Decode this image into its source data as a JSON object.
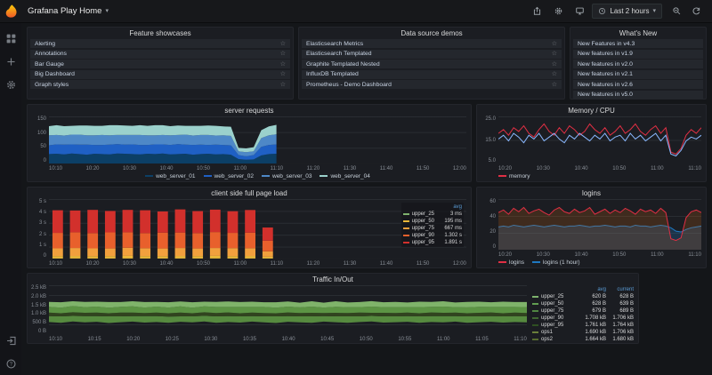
{
  "navbar": {
    "title": "Grafana Play Home",
    "time_range": "Last 2 hours"
  },
  "panels": {
    "feature_showcases": {
      "title": "Feature showcases",
      "star": true,
      "items": [
        "Alerting",
        "Annotations",
        "Bar Gauge",
        "Big Dashboard",
        "Graph styles"
      ]
    },
    "datasource_demos": {
      "title": "Data source demos",
      "star": true,
      "items": [
        "Elasticsearch Metrics",
        "Elasticsearch Templated",
        "Graphite Templated Nested",
        "InfluxDB Templated",
        "Prometheus - Demo Dashboard"
      ]
    },
    "whats_new": {
      "title": "What's New",
      "star": false,
      "items": [
        "New Features in v4.3",
        "New features in v1.9",
        "New features in v2.0",
        "New features in v2.1",
        "New features in v2.6",
        "New features in v5.0"
      ]
    },
    "server_requests": {
      "title": "server requests",
      "y_ticks": [
        "150",
        "100",
        "50",
        "0"
      ],
      "x_ticks": [
        "10:10",
        "10:20",
        "10:30",
        "10:40",
        "10:50",
        "11:00",
        "11:10",
        "11:20",
        "11:30",
        "11:40",
        "11:50",
        "12:00"
      ],
      "legend": [
        {
          "label": "web_server_01",
          "color": "#0c3f66"
        },
        {
          "label": "web_server_02",
          "color": "#1f60c4"
        },
        {
          "label": "web_server_03",
          "color": "#4e88c7"
        },
        {
          "label": "web_server_04",
          "color": "#9bd1cc"
        }
      ],
      "chart": {
        "type": "stacked_area",
        "ymax": 150,
        "span": 0.545,
        "series": [
          {
            "color": "#0c3f66",
            "values": [
              30,
              31,
              29,
              32,
              30,
              28,
              31,
              30,
              29,
              32,
              31,
              30,
              29,
              31,
              30,
              32,
              29,
              30,
              31,
              28,
              30,
              31,
              29,
              30,
              28,
              14,
              12,
              13,
              26,
              30,
              31
            ]
          },
          {
            "color": "#1f60c4",
            "values": [
              28,
              30,
              31,
              29,
              30,
              32,
              28,
              29,
              31,
              30,
              29,
              31,
              30,
              28,
              31,
              29,
              30,
              32,
              29,
              31,
              30,
              28,
              31,
              29,
              30,
              13,
              11,
              14,
              27,
              29,
              30
            ]
          },
          {
            "color": "#4e88c7",
            "values": [
              32,
              30,
              29,
              31,
              32,
              30,
              31,
              32,
              30,
              29,
              31,
              30,
              32,
              31,
              29,
              30,
              31,
              29,
              32,
              30,
              31,
              32,
              29,
              31,
              30,
              12,
              13,
              12,
              28,
              31,
              32
            ]
          },
          {
            "color": "#9bd1cc",
            "values": [
              29,
              31,
              30,
              28,
              29,
              31,
              30,
              29,
              32,
              31,
              30,
              29,
              31,
              30,
              32,
              31,
              29,
              30,
              28,
              31,
              29,
              30,
              31,
              28,
              29,
              11,
              12,
              13,
              25,
              28,
              30
            ]
          }
        ]
      }
    },
    "memory_cpu": {
      "title": "Memory / CPU",
      "y_ticks": [
        "25.0",
        "15.0",
        "5.0"
      ],
      "x_ticks": [
        "10:20",
        "10:30",
        "10:40",
        "10:50",
        "11:00",
        "11:10"
      ],
      "legend": [
        {
          "label": "memory",
          "color": "#e02f44"
        }
      ],
      "chart": {
        "type": "lines",
        "ymax": 25,
        "span": 1,
        "series": [
          {
            "color": "#e02f44",
            "values": [
              16,
              18,
              15,
              19,
              17,
              20,
              16,
              14,
              18,
              21,
              17,
              15,
              19,
              16,
              20,
              18,
              15,
              17,
              21,
              18,
              16,
              19,
              15,
              17,
              20,
              16,
              18,
              21,
              17,
              15,
              18,
              20,
              16,
              19,
              6,
              5,
              8,
              15,
              18,
              16,
              19
            ]
          },
          {
            "color": "#8ab8ff",
            "values": [
              13,
              15,
              12,
              16,
              14,
              11,
              15,
              13,
              16,
              12,
              14,
              16,
              13,
              11,
              15,
              13,
              16,
              14,
              12,
              15,
              13,
              16,
              12,
              14,
              15,
              12,
              16,
              13,
              15,
              12,
              14,
              16,
              12,
              15,
              5,
              4,
              7,
              12,
              14,
              13,
              15
            ]
          }
        ]
      }
    },
    "client_load": {
      "title": "client side full page load",
      "y_ticks": [
        "5 s",
        "4 s",
        "3 s",
        "2 s",
        "1 s",
        "0"
      ],
      "x_ticks": [
        "10:10",
        "10:20",
        "10:30",
        "10:40",
        "10:50",
        "11:00",
        "11:10",
        "11:20",
        "11:30",
        "11:40",
        "11:50",
        "12:00"
      ],
      "legend_table": {
        "headers": [
          "avg"
        ],
        "rows": [
          {
            "label": "upper_25",
            "color": "#7eb26d",
            "values": [
              "3 ms"
            ]
          },
          {
            "label": "upper_50",
            "color": "#eab839",
            "values": [
              "195 ms"
            ]
          },
          {
            "label": "upper_75",
            "color": "#f2a03d",
            "values": [
              "667 ms"
            ]
          },
          {
            "label": "upper_90",
            "color": "#e8602c",
            "values": [
              "1.302 s"
            ]
          },
          {
            "label": "upper_95",
            "color": "#d2302c",
            "values": [
              "1.891 s"
            ]
          }
        ]
      },
      "chart": {
        "type": "bars",
        "ymax": 5,
        "span": 0.545,
        "colors": [
          "#7eb26d",
          "#eab839",
          "#f2a03d",
          "#e8602c",
          "#d2302c"
        ],
        "stacks": [
          [
            0.01,
            0.2,
            0.65,
            1.3,
            1.9
          ],
          [
            0.01,
            0.21,
            0.67,
            1.32,
            1.83
          ],
          [
            0.01,
            0.19,
            0.66,
            1.28,
            1.95
          ],
          [
            0.01,
            0.2,
            0.64,
            1.35,
            1.8
          ],
          [
            0.01,
            0.22,
            0.68,
            1.3,
            1.88
          ],
          [
            0.01,
            0.2,
            0.66,
            1.27,
            1.92
          ],
          [
            0.01,
            0.19,
            0.65,
            1.33,
            1.78
          ],
          [
            0.01,
            0.21,
            0.67,
            1.3,
            1.94
          ],
          [
            0.01,
            0.2,
            0.64,
            1.29,
            1.85
          ],
          [
            0.01,
            0.22,
            0.66,
            1.34,
            1.88
          ],
          [
            0.01,
            0.2,
            0.67,
            1.28,
            1.82
          ],
          [
            0.01,
            0.21,
            0.65,
            1.31,
            1.9
          ],
          [
            0.01,
            0.15,
            0.45,
            0.9,
            1.1
          ]
        ]
      }
    },
    "logins": {
      "title": "logins",
      "y_ticks": [
        "60",
        "40",
        "20",
        "0"
      ],
      "x_ticks": [
        "10:20",
        "10:30",
        "10:40",
        "10:50",
        "11:00",
        "11:10"
      ],
      "legend": [
        {
          "label": "logins",
          "color": "#e02f44"
        },
        {
          "label": "logins (1 hour)",
          "color": "#1f78c1"
        }
      ],
      "chart": {
        "type": "lines",
        "ymax": 60,
        "span": 1,
        "series": [
          {
            "color": "#1f78c1",
            "fill": "rgba(31,120,193,0.25)",
            "values": [
              27,
              28,
              27,
              29,
              28,
              27,
              28,
              29,
              28,
              27,
              28,
              29,
              28,
              27,
              28,
              28,
              29,
              28,
              27,
              28,
              28,
              29,
              28,
              27,
              28,
              28,
              27,
              29,
              28,
              28,
              27,
              28,
              29,
              28,
              26,
              22,
              21,
              24,
              26,
              27,
              28
            ]
          },
          {
            "color": "#e02f44",
            "fill": "rgba(255,120,10,0.16)",
            "values": [
              44,
              47,
              42,
              49,
              45,
              50,
              43,
              46,
              48,
              44,
              41,
              47,
              50,
              45,
              43,
              48,
              44,
              46,
              50,
              42,
              45,
              48,
              43,
              47,
              44,
              49,
              46,
              42,
              48,
              45,
              47,
              43,
              49,
              44,
              13,
              11,
              14,
              38,
              45,
              47,
              44
            ]
          }
        ]
      }
    },
    "traffic": {
      "title": "Traffic In/Out",
      "y_ticks": [
        "2.5 kB",
        "2.0 kB",
        "1.5 kB",
        "1.0 kB",
        "500 B",
        "0 B"
      ],
      "x_ticks": [
        "10:10",
        "10:15",
        "10:20",
        "10:25",
        "10:30",
        "10:35",
        "10:40",
        "10:45",
        "10:50",
        "10:55",
        "11:00",
        "11:05",
        "11:10"
      ],
      "legend_table": {
        "headers": [
          "avg",
          "current"
        ],
        "rows": [
          {
            "label": "upper_25",
            "color": "#7eb26d",
            "values": [
              "620 B",
              "628 B"
            ]
          },
          {
            "label": "upper_50",
            "color": "#629e51",
            "values": [
              "628 B",
              "639 B"
            ]
          },
          {
            "label": "upper_75",
            "color": "#508642",
            "values": [
              "679 B",
              "689 B"
            ]
          },
          {
            "label": "upper_90",
            "color": "#3f6833",
            "values": [
              "1.708 kB",
              "1.706 kB"
            ]
          },
          {
            "label": "upper_95",
            "color": "#2f5022",
            "values": [
              "1.761 kB",
              "1.764 kB"
            ]
          },
          {
            "label": "ops1",
            "color": "#6a7f3a",
            "values": [
              "1.690 kB",
              "1.706 kB"
            ]
          },
          {
            "label": "ops2",
            "color": "#566b2f",
            "values": [
              "1.664 kB",
              "1.680 kB"
            ]
          }
        ]
      },
      "chart": {
        "type": "stacked_area",
        "ymax": 2.5,
        "span": 1,
        "series": [
          {
            "color": "none",
            "values": [
              0.62,
              0.58,
              0.65,
              0.6,
              0.63,
              0.57,
              0.61,
              0.64,
              0.59,
              0.62,
              0.58,
              0.63,
              0.6,
              0.65,
              0.58,
              0.62,
              0.59,
              0.64,
              0.6,
              0.57,
              0.63,
              0.6,
              0.58,
              0.64,
              0.61,
              0.58,
              0.62,
              0.65,
              0.59,
              0.61,
              0.63,
              0.58,
              0.62,
              0.6,
              0.64,
              0.58,
              0.61,
              0.63,
              0.59,
              0.62,
              0.6
            ]
          },
          {
            "color": "#568a3f",
            "values": [
              0.3,
              0.33,
              0.28,
              0.32,
              0.29,
              0.34,
              0.3,
              0.28,
              0.33,
              0.3,
              0.32,
              0.28,
              0.31,
              0.29,
              0.33,
              0.3,
              0.32,
              0.28,
              0.31,
              0.34,
              0.29,
              0.31,
              0.33,
              0.28,
              0.3,
              0.33,
              0.29,
              0.28,
              0.32,
              0.3,
              0.29,
              0.33,
              0.3,
              0.32,
              0.28,
              0.33,
              0.3,
              0.29,
              0.32,
              0.3,
              0.31
            ]
          },
          {
            "color": "#31441f",
            "values": [
              0.18,
              0.16,
              0.19,
              0.17,
              0.18,
              0.16,
              0.19,
              0.18,
              0.16,
              0.18,
              0.17,
              0.19,
              0.16,
              0.18,
              0.17,
              0.19,
              0.16,
              0.18,
              0.17,
              0.16,
              0.19,
              0.17,
              0.18,
              0.16,
              0.18,
              0.17,
              0.19,
              0.16,
              0.18,
              0.17,
              0.18,
              0.16,
              0.19,
              0.17,
              0.18,
              0.16,
              0.18,
              0.19,
              0.16,
              0.18,
              0.17
            ]
          },
          {
            "color": "#5c9444",
            "values": [
              0.3,
              0.28,
              0.32,
              0.29,
              0.31,
              0.28,
              0.3,
              0.32,
              0.28,
              0.31,
              0.29,
              0.32,
              0.28,
              0.3,
              0.31,
              0.28,
              0.32,
              0.29,
              0.31,
              0.28,
              0.3,
              0.29,
              0.32,
              0.28,
              0.31,
              0.3,
              0.28,
              0.32,
              0.29,
              0.3,
              0.28,
              0.31,
              0.29,
              0.32,
              0.28,
              0.3,
              0.31,
              0.28,
              0.32,
              0.29,
              0.3
            ]
          },
          {
            "color": "#7fb36a",
            "values": [
              0.25,
              0.28,
              0.24,
              0.27,
              0.25,
              0.29,
              0.24,
              0.26,
              0.28,
              0.24,
              0.27,
              0.25,
              0.28,
              0.24,
              0.26,
              0.28,
              0.25,
              0.27,
              0.24,
              0.28,
              0.26,
              0.24,
              0.27,
              0.25,
              0.28,
              0.24,
              0.26,
              0.28,
              0.25,
              0.27,
              0.24,
              0.28,
              0.25,
              0.27,
              0.24,
              0.28,
              0.26,
              0.24,
              0.27,
              0.25,
              0.26
            ]
          }
        ]
      }
    }
  }
}
